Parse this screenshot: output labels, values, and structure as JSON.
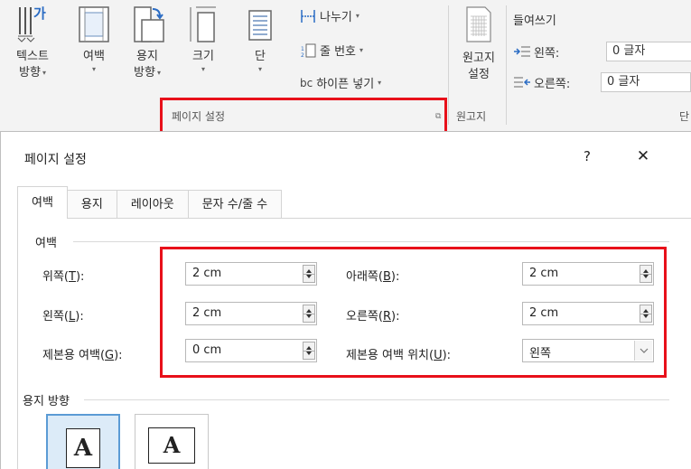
{
  "ribbon": {
    "buttons": {
      "text_direction": {
        "line1": "텍스트",
        "line2": "방향"
      },
      "margins": {
        "line1": "여백"
      },
      "orientation": {
        "line1": "용지",
        "line2": "방향"
      },
      "size": {
        "line1": "크기"
      },
      "columns": {
        "line1": "단"
      }
    },
    "small": {
      "breaks": "나누기",
      "line_numbers": "줄 번호",
      "hyphenation": "하이픈 넣기",
      "hyphen_icon_text": "bc"
    },
    "manuscript": {
      "line1": "원고지",
      "line2": "설정",
      "group": "원고지"
    },
    "groups": {
      "page_setup": "페이지 설정",
      "paragraph_partial": "단"
    },
    "indent": {
      "title": "들여쓰기",
      "left_label": "왼쪽:",
      "left_value": "0 글자",
      "right_label": "오른쪽:",
      "right_value": "0 글자"
    }
  },
  "dialog": {
    "title": "페이지 설정",
    "help": "?",
    "close": "✕",
    "tabs": [
      "여백",
      "용지",
      "레이아웃",
      "문자 수/줄 수"
    ],
    "active_tab": "여백",
    "margins_section": "여백",
    "fields": {
      "top": {
        "label": "위쪽",
        "key": "T",
        "value": "2 cm"
      },
      "bottom": {
        "label": "아래쪽",
        "key": "B",
        "value": "2 cm"
      },
      "left": {
        "label": "왼쪽",
        "key": "L",
        "value": "2 cm"
      },
      "right": {
        "label": "오른쪽",
        "key": "R",
        "value": "2 cm"
      },
      "gutter": {
        "label": "제본용 여백",
        "key": "G",
        "value": "0 cm"
      },
      "gutter_pos": {
        "label": "제본용 여백 위치",
        "key": "U",
        "value": "왼쪽"
      }
    },
    "orientation_section": "용지 방향",
    "orientation_glyph": "A"
  },
  "colors": {
    "highlight": "#e8101a",
    "selected": "#5b9bd5",
    "ribbon_bg": "#f3f3f3"
  },
  "icons": [
    "text-direction-icon",
    "margins-icon",
    "orientation-icon",
    "size-icon",
    "columns-icon",
    "breaks-icon",
    "line-numbers-icon",
    "hyphenation-icon",
    "manuscript-icon",
    "indent-left-icon",
    "indent-right-icon",
    "dialog-launcher-icon",
    "help-icon",
    "close-icon",
    "portrait-icon",
    "landscape-icon"
  ]
}
